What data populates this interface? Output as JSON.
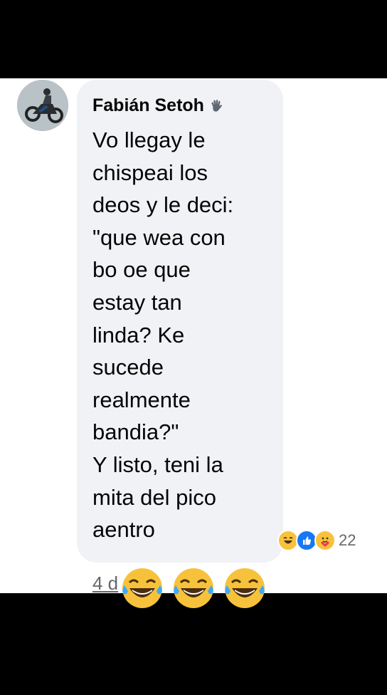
{
  "comment": {
    "author": "Fabián Setoh",
    "author_badge_icon": "waving-hand-icon",
    "lines": [
      "Vo llegay le",
      "chispeai los",
      "deos y le deci:",
      "\"que wea con",
      "bo oe que",
      "estay tan",
      "linda? Ke",
      "sucede",
      "realmente",
      "bandia?\"",
      "Y listo, teni la",
      "mita del pico",
      "aentro"
    ],
    "time": "4 d",
    "reactions": {
      "icons": [
        "haha-icon",
        "like-icon",
        "care-icon"
      ],
      "count": "22"
    }
  },
  "overlay": {
    "emojis": [
      "tears-of-joy-icon",
      "tears-of-joy-icon",
      "tears-of-joy-icon"
    ]
  },
  "colors": {
    "background": "#000000",
    "panel": "#ffffff",
    "bubble": "#f0f2f5",
    "text": "#050505",
    "secondary_text": "#65676b",
    "like_blue": "#1877f2",
    "emoji_yellow": "#f7c23b"
  }
}
